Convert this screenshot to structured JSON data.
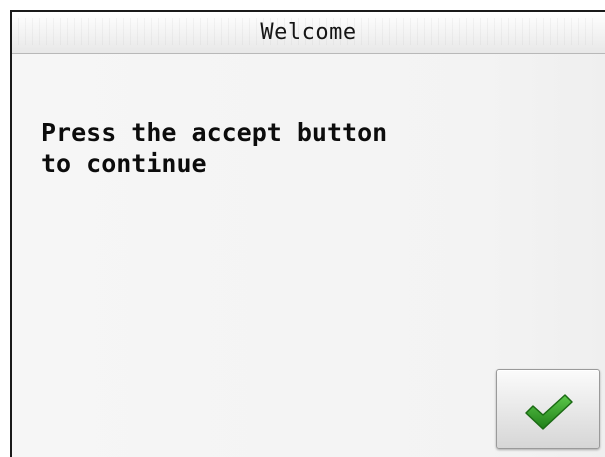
{
  "window": {
    "title": "Welcome"
  },
  "content": {
    "message": "Press the accept button\nto continue"
  },
  "accept_button": {
    "icon": "checkmark-icon",
    "color": "#2f9a24"
  }
}
